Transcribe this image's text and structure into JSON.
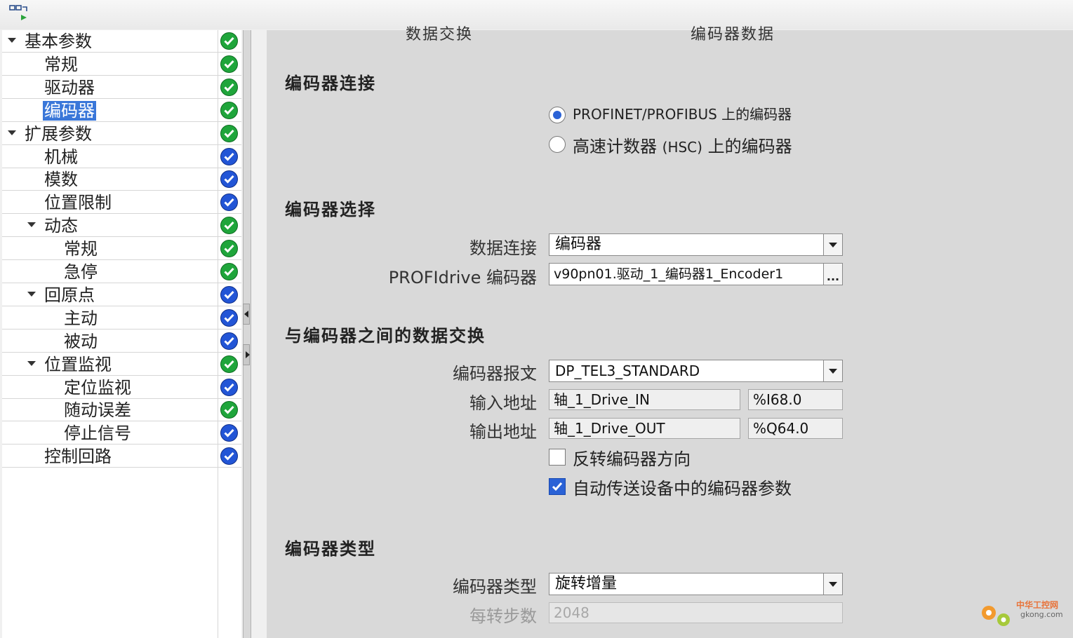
{
  "nav": {
    "items": [
      {
        "label": "基本参数",
        "level": 0,
        "expandable": true,
        "status": "ok"
      },
      {
        "label": "常规",
        "level": 1,
        "expandable": false,
        "status": "ok"
      },
      {
        "label": "驱动器",
        "level": 1,
        "expandable": false,
        "status": "ok"
      },
      {
        "label": "编码器",
        "level": 1,
        "expandable": false,
        "status": "ok",
        "selected": true
      },
      {
        "label": "扩展参数",
        "level": 0,
        "expandable": true,
        "status": "ok"
      },
      {
        "label": "机械",
        "level": 1,
        "expandable": false,
        "status": "blue"
      },
      {
        "label": "模数",
        "level": 1,
        "expandable": false,
        "status": "blue"
      },
      {
        "label": "位置限制",
        "level": 1,
        "expandable": false,
        "status": "blue"
      },
      {
        "label": "动态",
        "level": 1,
        "expandable": true,
        "status": "ok"
      },
      {
        "label": "常规",
        "level": 2,
        "expandable": false,
        "status": "ok"
      },
      {
        "label": "急停",
        "level": 2,
        "expandable": false,
        "status": "ok"
      },
      {
        "label": "回原点",
        "level": 1,
        "expandable": true,
        "status": "blue"
      },
      {
        "label": "主动",
        "level": 2,
        "expandable": false,
        "status": "blue"
      },
      {
        "label": "被动",
        "level": 2,
        "expandable": false,
        "status": "blue"
      },
      {
        "label": "位置监视",
        "level": 1,
        "expandable": true,
        "status": "ok"
      },
      {
        "label": "定位监视",
        "level": 2,
        "expandable": false,
        "status": "blue"
      },
      {
        "label": "随动误差",
        "level": 2,
        "expandable": false,
        "status": "ok"
      },
      {
        "label": "停止信号",
        "level": 2,
        "expandable": false,
        "status": "blue"
      },
      {
        "label": "控制回路",
        "level": 1,
        "expandable": false,
        "status": "blue"
      }
    ]
  },
  "header_cut": {
    "left": "数据交换",
    "right": "编码器数据"
  },
  "connection": {
    "title": "编码器连接",
    "opt1": "PROFINET/PROFIBUS 上的编码器",
    "opt2_a": "高速计数器 ",
    "opt2_b": "(HSC)",
    "opt2_c": " 上的编码器",
    "selected": 1
  },
  "selection": {
    "title": "编码器选择",
    "data_conn_label": "数据连接",
    "data_conn_value": "编码器",
    "profidrive_label": "PROFIdrive",
    "profidrive_label2": " 编码器",
    "profidrive_value": "v90pn01.驱动_1_编码器1_Encoder1",
    "dots": "..."
  },
  "exchange": {
    "title": "与编码器之间的数据交换",
    "telegram_label": "编码器报文",
    "telegram_value": "DP_TEL3_STANDARD",
    "in_label": "输入地址",
    "in_value": "轴_1_Drive_IN",
    "in_addr": "%I68.0",
    "out_label": "输出地址",
    "out_value": "轴_1_Drive_OUT",
    "out_addr": "%Q64.0",
    "invert_label": "反转编码器方向",
    "invert_checked": false,
    "auto_label": "自动传送设备中的编码器参数",
    "auto_checked": true
  },
  "type": {
    "title": "编码器类型",
    "type_label": "编码器类型",
    "type_value": "旋转增量",
    "steps_label": "每转步数",
    "steps_value": "2048"
  },
  "colon": "：",
  "watermark": {
    "line1": "中华工控网",
    "line2": "gkong.com"
  },
  "colors": {
    "ok": "#1fa53b",
    "info": "#2255d6",
    "accent": "#2a62d6",
    "selected": "#3a77d9"
  }
}
